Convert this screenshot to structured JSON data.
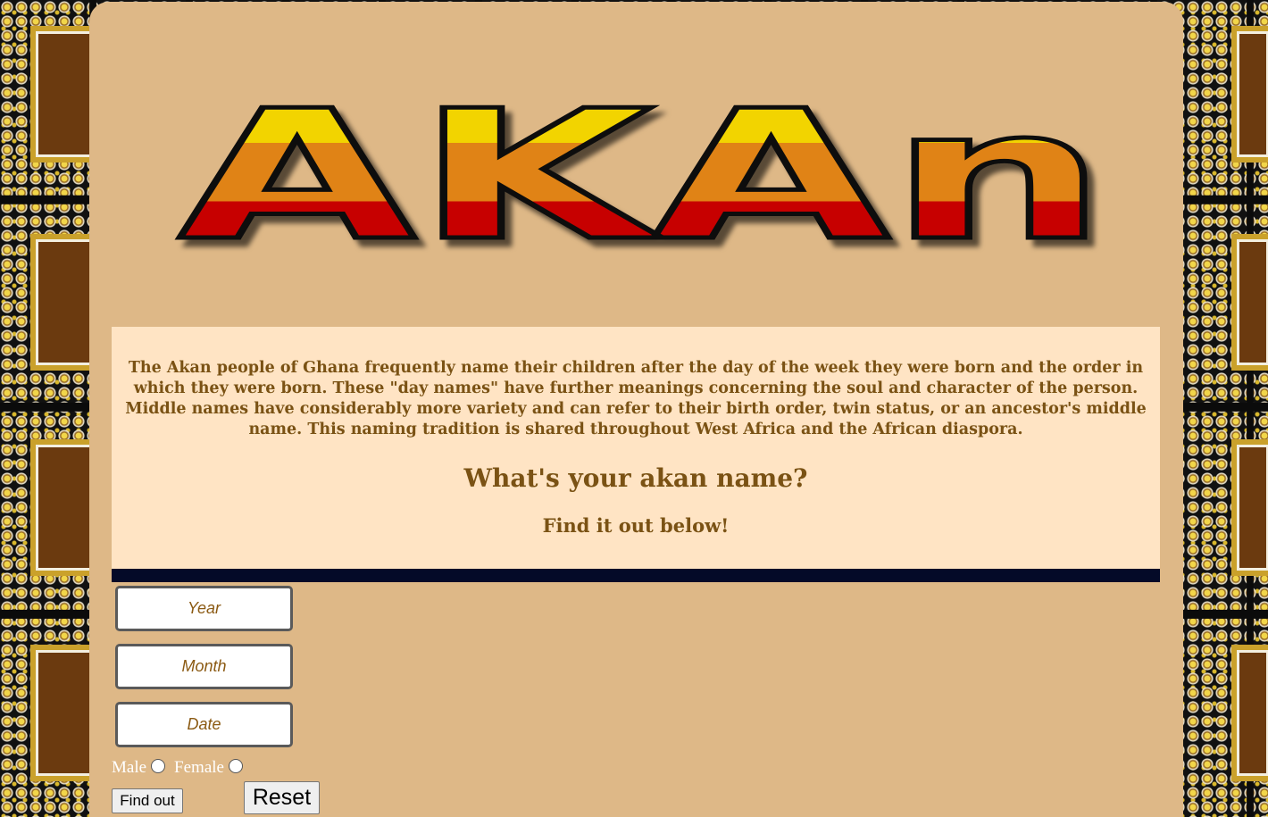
{
  "logo": {
    "text": "AKAn",
    "colors": {
      "top": "#f2d400",
      "middle": "#e08312",
      "bottom": "#c70000",
      "outline": "#111111"
    }
  },
  "intro": {
    "paragraph": "The Akan people of Ghana frequently name their children after the day of the week they were born and the order in which they were born. These \"day names\" have further meanings concerning the soul and character of the person. Middle names have considerably more variety and can refer to their birth order, twin status, or an ancestor's middle name. This naming tradition is shared throughout West Africa and the African diaspora.",
    "heading": "What's your akan name?",
    "subheading": "Find it out below!"
  },
  "form": {
    "year_placeholder": "Year",
    "month_placeholder": "Month",
    "date_placeholder": "Date",
    "male_label": "Male",
    "female_label": "Female",
    "find_button": "Find out",
    "reset_button": "Reset"
  },
  "theme": {
    "card_bg": "#deb887",
    "intro_bg": "#ffe4c4",
    "text_color": "#7a5214",
    "bar_color": "#040a28"
  }
}
